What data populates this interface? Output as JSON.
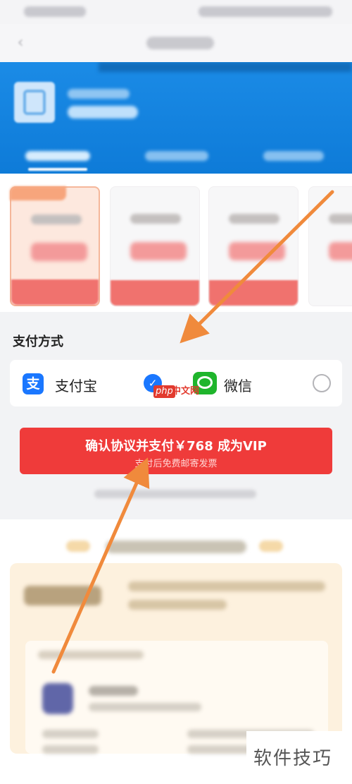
{
  "payment_section": {
    "title": "支付方式",
    "methods": [
      {
        "label": "支付宝",
        "icon": "alipay-icon",
        "selected": true
      },
      {
        "label": "微信",
        "icon": "wechat-icon",
        "selected": false
      }
    ]
  },
  "watermark": {
    "php": "php",
    "site": "中文网"
  },
  "confirm_button": {
    "label": "确认协议并支付￥768 成为VIP",
    "sub_label": "支付后免费邮寄发票"
  },
  "corner_watermark": "软件技巧",
  "colors": {
    "brand_blue": "#0e7bd8",
    "pay_red": "#ef3b3a",
    "alipay_blue": "#1a77ff",
    "wechat_green": "#1fb52c",
    "arrow_orange": "#f08a3c"
  }
}
